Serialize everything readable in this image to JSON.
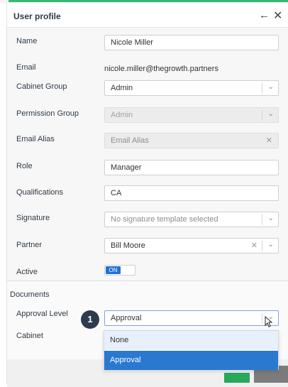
{
  "header": {
    "title": "User profile",
    "back_glyph": "←",
    "close_glyph": "✕"
  },
  "fields": {
    "name": {
      "label": "Name",
      "value": "Nicole Miller"
    },
    "email": {
      "label": "Email",
      "value": "nicole.miller@thegrowth.partners"
    },
    "cabinet_group": {
      "label": "Cabinet Group",
      "value": "Admin"
    },
    "permission_group": {
      "label": "Permission Group",
      "value": "Admin"
    },
    "email_alias": {
      "label": "Email Alias",
      "placeholder": "Email Alias"
    },
    "role": {
      "label": "Role",
      "value": "Manager"
    },
    "qualifications": {
      "label": "Qualifications",
      "value": "CA"
    },
    "signature": {
      "label": "Signature",
      "value": "No signature template selected"
    },
    "partner": {
      "label": "Partner",
      "value": "Bill Moore"
    },
    "active": {
      "label": "Active",
      "toggle_text": "ON"
    }
  },
  "documents": {
    "section_title": "Documents",
    "approval_level": {
      "label": "Approval Level",
      "value": "Approval"
    },
    "cabinet": {
      "label": "Cabinet"
    },
    "dropdown_options": [
      "None",
      "Approval"
    ]
  },
  "step_badge": "1",
  "glyphs": {
    "chevron": "⌄",
    "clear": "✕"
  },
  "colors": {
    "accent_green": "#39b873",
    "primary_blue": "#2a78d0",
    "toggle_blue": "#1f72d6",
    "badge_dark": "#2e3b4e"
  }
}
